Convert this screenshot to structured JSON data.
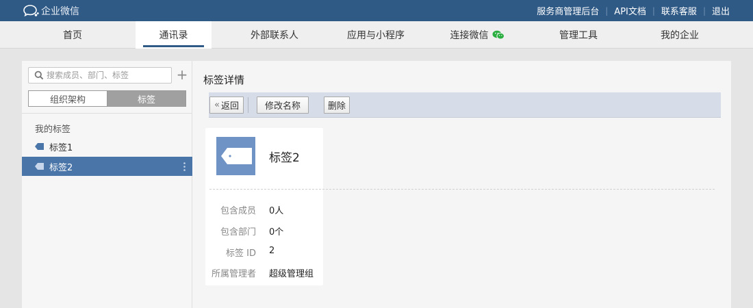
{
  "app": {
    "title": "企业微信"
  },
  "header": {
    "links": [
      "服务商管理后台",
      "API文档",
      "联系客服",
      "退出"
    ]
  },
  "nav": {
    "items": [
      "首页",
      "通讯录",
      "外部联系人",
      "应用与小程序",
      "连接微信",
      "管理工具",
      "我的企业"
    ],
    "active": "通讯录"
  },
  "sidebar": {
    "search_placeholder": "搜索成员、部门、标签",
    "add_label": "+",
    "seg_left": "组织架构",
    "seg_right": "标签",
    "heading": "我的标签",
    "tags": [
      "标签1",
      "标签2"
    ],
    "selected_tag": "标签2"
  },
  "detail": {
    "title": "标签详情",
    "back_label": "返回",
    "rename_label": "修改名称",
    "delete_label": "删除",
    "tag_name": "标签2",
    "fields": [
      {
        "key": "包含成员",
        "value": "0人"
      },
      {
        "key": "包含部门",
        "value": "0个"
      },
      {
        "key": "标签 ID",
        "value": "2"
      },
      {
        "key": "所属管理者",
        "value": "超级管理组"
      }
    ]
  },
  "colors": {
    "topbar": "#2f5a86",
    "accent": "#4a75a8",
    "tag_icon": "#6e93c4",
    "wechat_green": "#2aae3f"
  }
}
